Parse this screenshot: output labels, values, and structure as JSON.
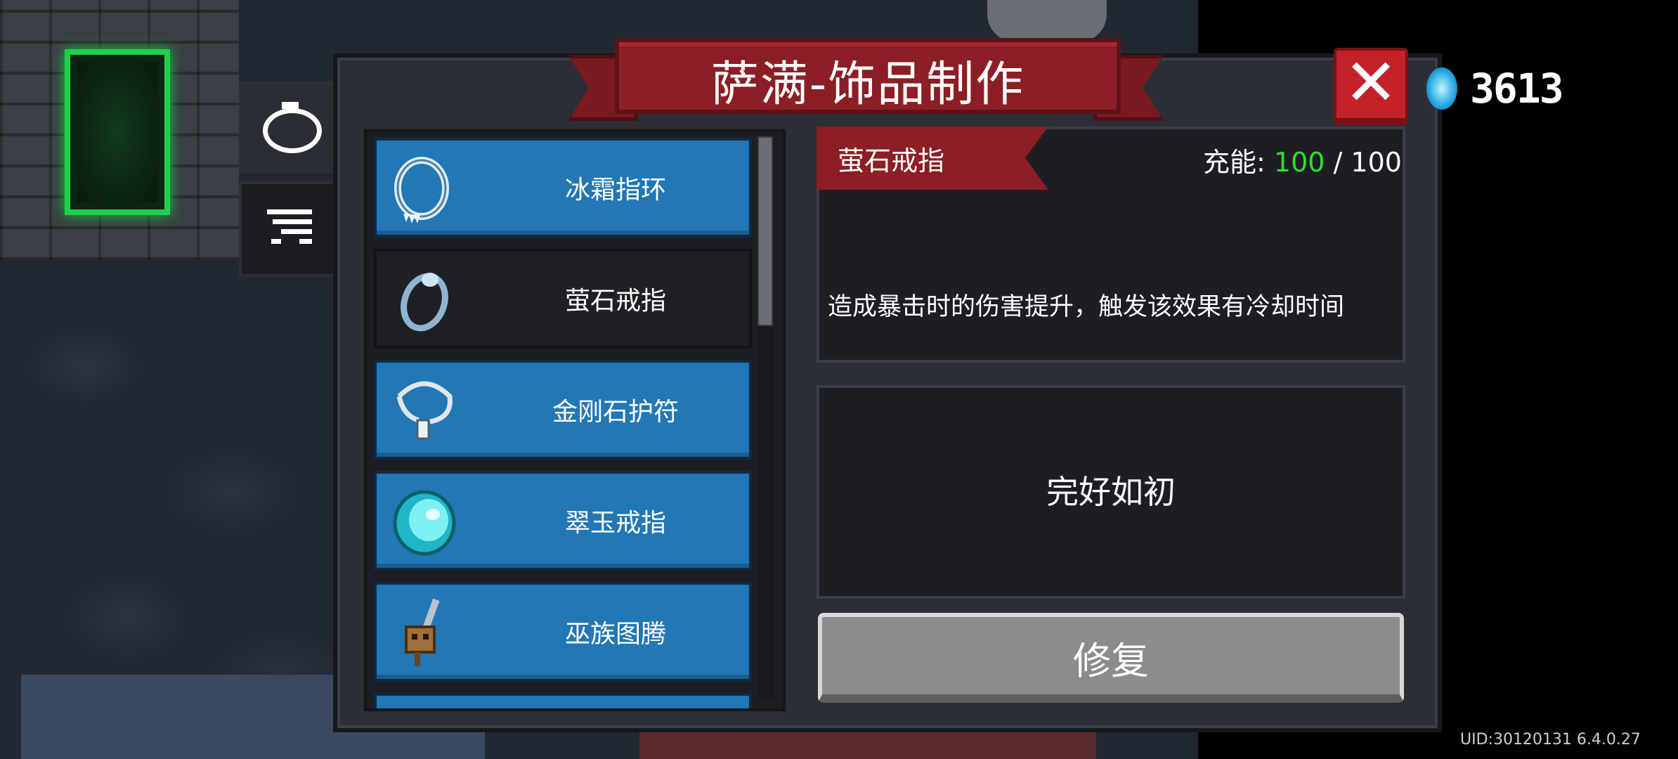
{
  "title": "萨满-饰品制作",
  "close_label": "✕",
  "currency": {
    "icon": "blue-gem-icon",
    "amount": "3613"
  },
  "side_tabs": [
    {
      "icon": "ring-icon",
      "selected": true
    },
    {
      "icon": "filter-icon",
      "selected": false
    }
  ],
  "items": [
    {
      "label": "冰霜指环",
      "icon": "frost-ring-icon",
      "state": "blue"
    },
    {
      "label": "萤石戒指",
      "icon": "fluorite-ring-icon",
      "state": "selected"
    },
    {
      "label": "金刚石护符",
      "icon": "diamond-amulet-icon",
      "state": "blue"
    },
    {
      "label": "翠玉戒指",
      "icon": "jade-ring-icon",
      "state": "blue"
    },
    {
      "label": "巫族图腾",
      "icon": "witch-totem-icon",
      "state": "blue"
    }
  ],
  "detail": {
    "name": "萤石戒指",
    "charge_label": "充能:",
    "charge_current": "100",
    "charge_max": "/ 100",
    "description": "造成暴击时的伤害提升，触发该效果有冷却时间",
    "status": "完好如初",
    "repair_label": "修复"
  },
  "uid": "UID:30120131 6.4.0.27",
  "colors": {
    "accent_red": "#8c1e25",
    "item_blue": "#2277b5",
    "charge_green": "#2ee02b"
  }
}
